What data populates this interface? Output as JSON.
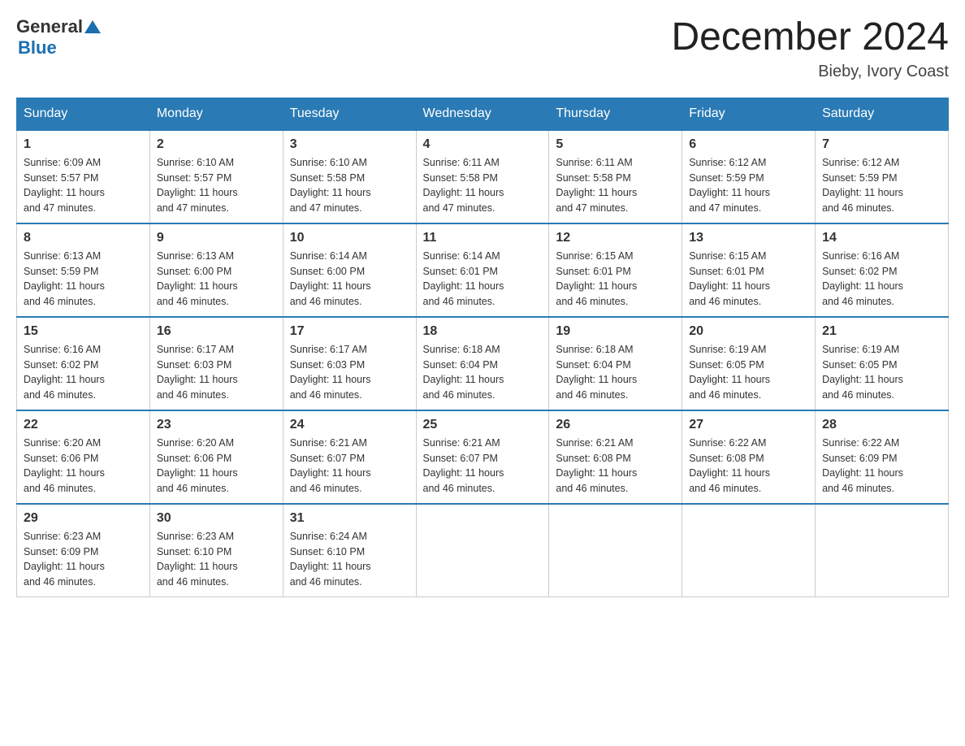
{
  "header": {
    "logo_general": "General",
    "logo_blue": "Blue",
    "month_title": "December 2024",
    "location": "Bieby, Ivory Coast"
  },
  "days_of_week": [
    "Sunday",
    "Monday",
    "Tuesday",
    "Wednesday",
    "Thursday",
    "Friday",
    "Saturday"
  ],
  "weeks": [
    [
      {
        "day": "1",
        "sunrise": "6:09 AM",
        "sunset": "5:57 PM",
        "daylight": "11 hours and 47 minutes."
      },
      {
        "day": "2",
        "sunrise": "6:10 AM",
        "sunset": "5:57 PM",
        "daylight": "11 hours and 47 minutes."
      },
      {
        "day": "3",
        "sunrise": "6:10 AM",
        "sunset": "5:58 PM",
        "daylight": "11 hours and 47 minutes."
      },
      {
        "day": "4",
        "sunrise": "6:11 AM",
        "sunset": "5:58 PM",
        "daylight": "11 hours and 47 minutes."
      },
      {
        "day": "5",
        "sunrise": "6:11 AM",
        "sunset": "5:58 PM",
        "daylight": "11 hours and 47 minutes."
      },
      {
        "day": "6",
        "sunrise": "6:12 AM",
        "sunset": "5:59 PM",
        "daylight": "11 hours and 47 minutes."
      },
      {
        "day": "7",
        "sunrise": "6:12 AM",
        "sunset": "5:59 PM",
        "daylight": "11 hours and 46 minutes."
      }
    ],
    [
      {
        "day": "8",
        "sunrise": "6:13 AM",
        "sunset": "5:59 PM",
        "daylight": "11 hours and 46 minutes."
      },
      {
        "day": "9",
        "sunrise": "6:13 AM",
        "sunset": "6:00 PM",
        "daylight": "11 hours and 46 minutes."
      },
      {
        "day": "10",
        "sunrise": "6:14 AM",
        "sunset": "6:00 PM",
        "daylight": "11 hours and 46 minutes."
      },
      {
        "day": "11",
        "sunrise": "6:14 AM",
        "sunset": "6:01 PM",
        "daylight": "11 hours and 46 minutes."
      },
      {
        "day": "12",
        "sunrise": "6:15 AM",
        "sunset": "6:01 PM",
        "daylight": "11 hours and 46 minutes."
      },
      {
        "day": "13",
        "sunrise": "6:15 AM",
        "sunset": "6:01 PM",
        "daylight": "11 hours and 46 minutes."
      },
      {
        "day": "14",
        "sunrise": "6:16 AM",
        "sunset": "6:02 PM",
        "daylight": "11 hours and 46 minutes."
      }
    ],
    [
      {
        "day": "15",
        "sunrise": "6:16 AM",
        "sunset": "6:02 PM",
        "daylight": "11 hours and 46 minutes."
      },
      {
        "day": "16",
        "sunrise": "6:17 AM",
        "sunset": "6:03 PM",
        "daylight": "11 hours and 46 minutes."
      },
      {
        "day": "17",
        "sunrise": "6:17 AM",
        "sunset": "6:03 PM",
        "daylight": "11 hours and 46 minutes."
      },
      {
        "day": "18",
        "sunrise": "6:18 AM",
        "sunset": "6:04 PM",
        "daylight": "11 hours and 46 minutes."
      },
      {
        "day": "19",
        "sunrise": "6:18 AM",
        "sunset": "6:04 PM",
        "daylight": "11 hours and 46 minutes."
      },
      {
        "day": "20",
        "sunrise": "6:19 AM",
        "sunset": "6:05 PM",
        "daylight": "11 hours and 46 minutes."
      },
      {
        "day": "21",
        "sunrise": "6:19 AM",
        "sunset": "6:05 PM",
        "daylight": "11 hours and 46 minutes."
      }
    ],
    [
      {
        "day": "22",
        "sunrise": "6:20 AM",
        "sunset": "6:06 PM",
        "daylight": "11 hours and 46 minutes."
      },
      {
        "day": "23",
        "sunrise": "6:20 AM",
        "sunset": "6:06 PM",
        "daylight": "11 hours and 46 minutes."
      },
      {
        "day": "24",
        "sunrise": "6:21 AM",
        "sunset": "6:07 PM",
        "daylight": "11 hours and 46 minutes."
      },
      {
        "day": "25",
        "sunrise": "6:21 AM",
        "sunset": "6:07 PM",
        "daylight": "11 hours and 46 minutes."
      },
      {
        "day": "26",
        "sunrise": "6:21 AM",
        "sunset": "6:08 PM",
        "daylight": "11 hours and 46 minutes."
      },
      {
        "day": "27",
        "sunrise": "6:22 AM",
        "sunset": "6:08 PM",
        "daylight": "11 hours and 46 minutes."
      },
      {
        "day": "28",
        "sunrise": "6:22 AM",
        "sunset": "6:09 PM",
        "daylight": "11 hours and 46 minutes."
      }
    ],
    [
      {
        "day": "29",
        "sunrise": "6:23 AM",
        "sunset": "6:09 PM",
        "daylight": "11 hours and 46 minutes."
      },
      {
        "day": "30",
        "sunrise": "6:23 AM",
        "sunset": "6:10 PM",
        "daylight": "11 hours and 46 minutes."
      },
      {
        "day": "31",
        "sunrise": "6:24 AM",
        "sunset": "6:10 PM",
        "daylight": "11 hours and 46 minutes."
      },
      null,
      null,
      null,
      null
    ]
  ],
  "labels": {
    "sunrise": "Sunrise: ",
    "sunset": "Sunset: ",
    "daylight": "Daylight: "
  }
}
